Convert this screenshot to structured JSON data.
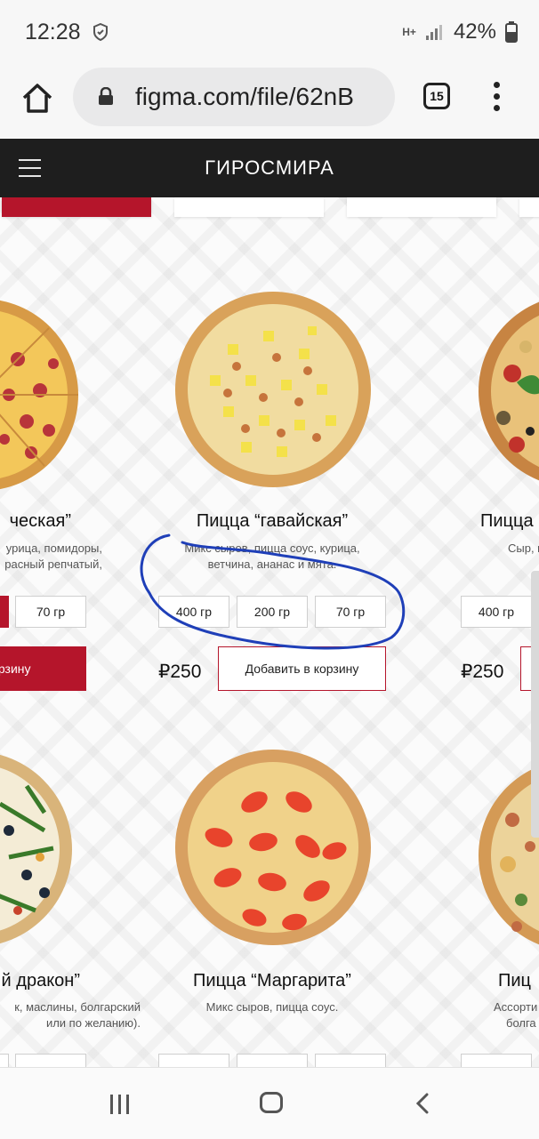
{
  "status": {
    "time": "12:28",
    "battery": "42%",
    "network": "H+"
  },
  "browser": {
    "url": "figma.com/file/62nB",
    "tab_count": "15"
  },
  "site": {
    "title": "ГИРОСМИРА"
  },
  "products": [
    {
      "name": "ческая”",
      "desc_lines": [
        "урица, помидоры,",
        "расный репчатый,"
      ],
      "sizes": [
        "70 гр"
      ],
      "price": "",
      "cart_label": "в корзину"
    },
    {
      "name": "Пицца “гавайская”",
      "desc_lines": [
        "Микс сыров, пицца соус, курица,",
        "ветчина, ананас и мята."
      ],
      "sizes": [
        "400 гр",
        "200 гр",
        "70 гр"
      ],
      "price": "₽250",
      "cart_label": "Добавить в корзину"
    },
    {
      "name": "Пицца",
      "desc_lines": [
        "Сыр, п"
      ],
      "sizes": [
        "400 гр"
      ],
      "price": "₽250",
      "cart_label": ""
    },
    {
      "name": "й дракон”",
      "desc_lines": [
        "к, маслины, болгарский",
        "или по желанию)."
      ],
      "sizes": [],
      "price": "",
      "cart_label": ""
    },
    {
      "name": "Пицца “Маргарита”",
      "desc_lines": [
        "Микс сыров, пицца соус."
      ],
      "sizes": [],
      "price": "",
      "cart_label": ""
    },
    {
      "name": "Пиц",
      "desc_lines": [
        "Ассорти",
        "болга"
      ],
      "sizes": [],
      "price": "",
      "cart_label": ""
    }
  ],
  "colors": {
    "accent": "#b5152b",
    "header_bg": "#1e1e1e",
    "annotation": "#1f3fb8"
  }
}
